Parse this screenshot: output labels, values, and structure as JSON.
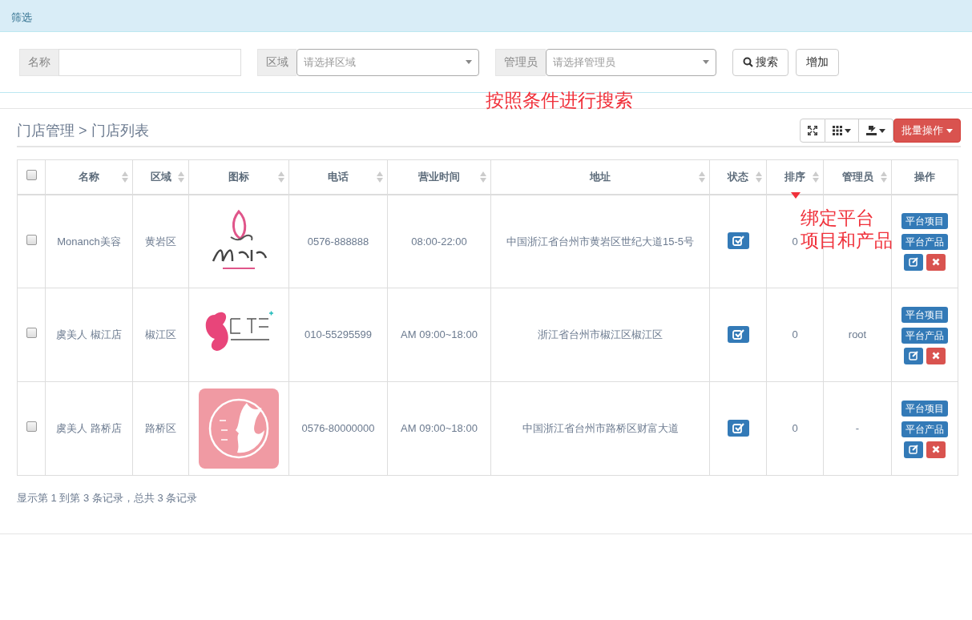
{
  "filter_panel": {
    "title": "筛选",
    "fields": [
      {
        "label": "名称",
        "kind": "text"
      },
      {
        "label": "区域",
        "kind": "select",
        "placeholder": "请选择区域"
      },
      {
        "label": "管理员",
        "kind": "select",
        "placeholder": "请选择管理员"
      }
    ],
    "buttons": [
      {
        "label": "搜索",
        "kind": "search"
      },
      {
        "label": "增加",
        "kind": "plain"
      }
    ]
  },
  "annotations": [
    {
      "lines": [
        "按照条件进行搜索"
      ]
    },
    {
      "lines": [
        "绑定平台",
        "项目和产品"
      ]
    }
  ],
  "breadcrumb": {
    "items": [
      "门店管理",
      "门店列表"
    ],
    "separator": ">"
  },
  "toolbar": {
    "icon_buttons": [
      {
        "kind": "fullscreen",
        "dropdown": false
      },
      {
        "kind": "columns",
        "dropdown": true
      },
      {
        "kind": "export",
        "dropdown": true
      }
    ],
    "batch_button": "批量操作"
  },
  "table": {
    "select_all_checked": false,
    "columns": [
      {
        "label": "名称",
        "sortable": true
      },
      {
        "label": "区域",
        "sortable": true
      },
      {
        "label": "图标",
        "sortable": true
      },
      {
        "label": "电话",
        "sortable": true
      },
      {
        "label": "营业时间",
        "sortable": true
      },
      {
        "label": "地址",
        "sortable": true
      },
      {
        "label": "状态",
        "sortable": true
      },
      {
        "label": "排序",
        "sortable": true
      },
      {
        "label": "管理员",
        "sortable": true
      },
      {
        "label": "操作",
        "sortable": false
      }
    ],
    "rows": [
      {
        "checked": false,
        "name": "Monanch美容",
        "region": "黄岩区",
        "logo": {
          "kind": "butterfly"
        },
        "phone": "0576-888888",
        "hours": "08:00-22:00",
        "address": "中国浙江省台州市黄岩区世纪大道15-5号",
        "status_on": true,
        "sort": "0",
        "actions": [
          "平台项目",
          "平台产品"
        ]
      },
      {
        "checked": false,
        "name": "虞美人 椒江店",
        "region": "椒江区",
        "logo": {
          "kind": "heart"
        },
        "phone": "010-55295599",
        "hours": "AM 09:00~18:00",
        "address": "浙江省台州市椒江区椒江区",
        "status_on": true,
        "sort": "0",
        "admin": "root",
        "actions": [
          "平台项目",
          "平台产品"
        ]
      },
      {
        "checked": false,
        "name": "虞美人 路桥店",
        "region": "路桥区",
        "logo": {
          "kind": "profile"
        },
        "phone": "0576-80000000",
        "hours": "AM 09:00~18:00",
        "address": "中国浙江省台州市路桥区财富大道",
        "status_on": true,
        "sort": "0",
        "admin": "-",
        "actions": [
          "平台项目",
          "平台产品"
        ]
      }
    ]
  },
  "footer": "显示第 1 到第 3 条记录，总共 3 条记录"
}
